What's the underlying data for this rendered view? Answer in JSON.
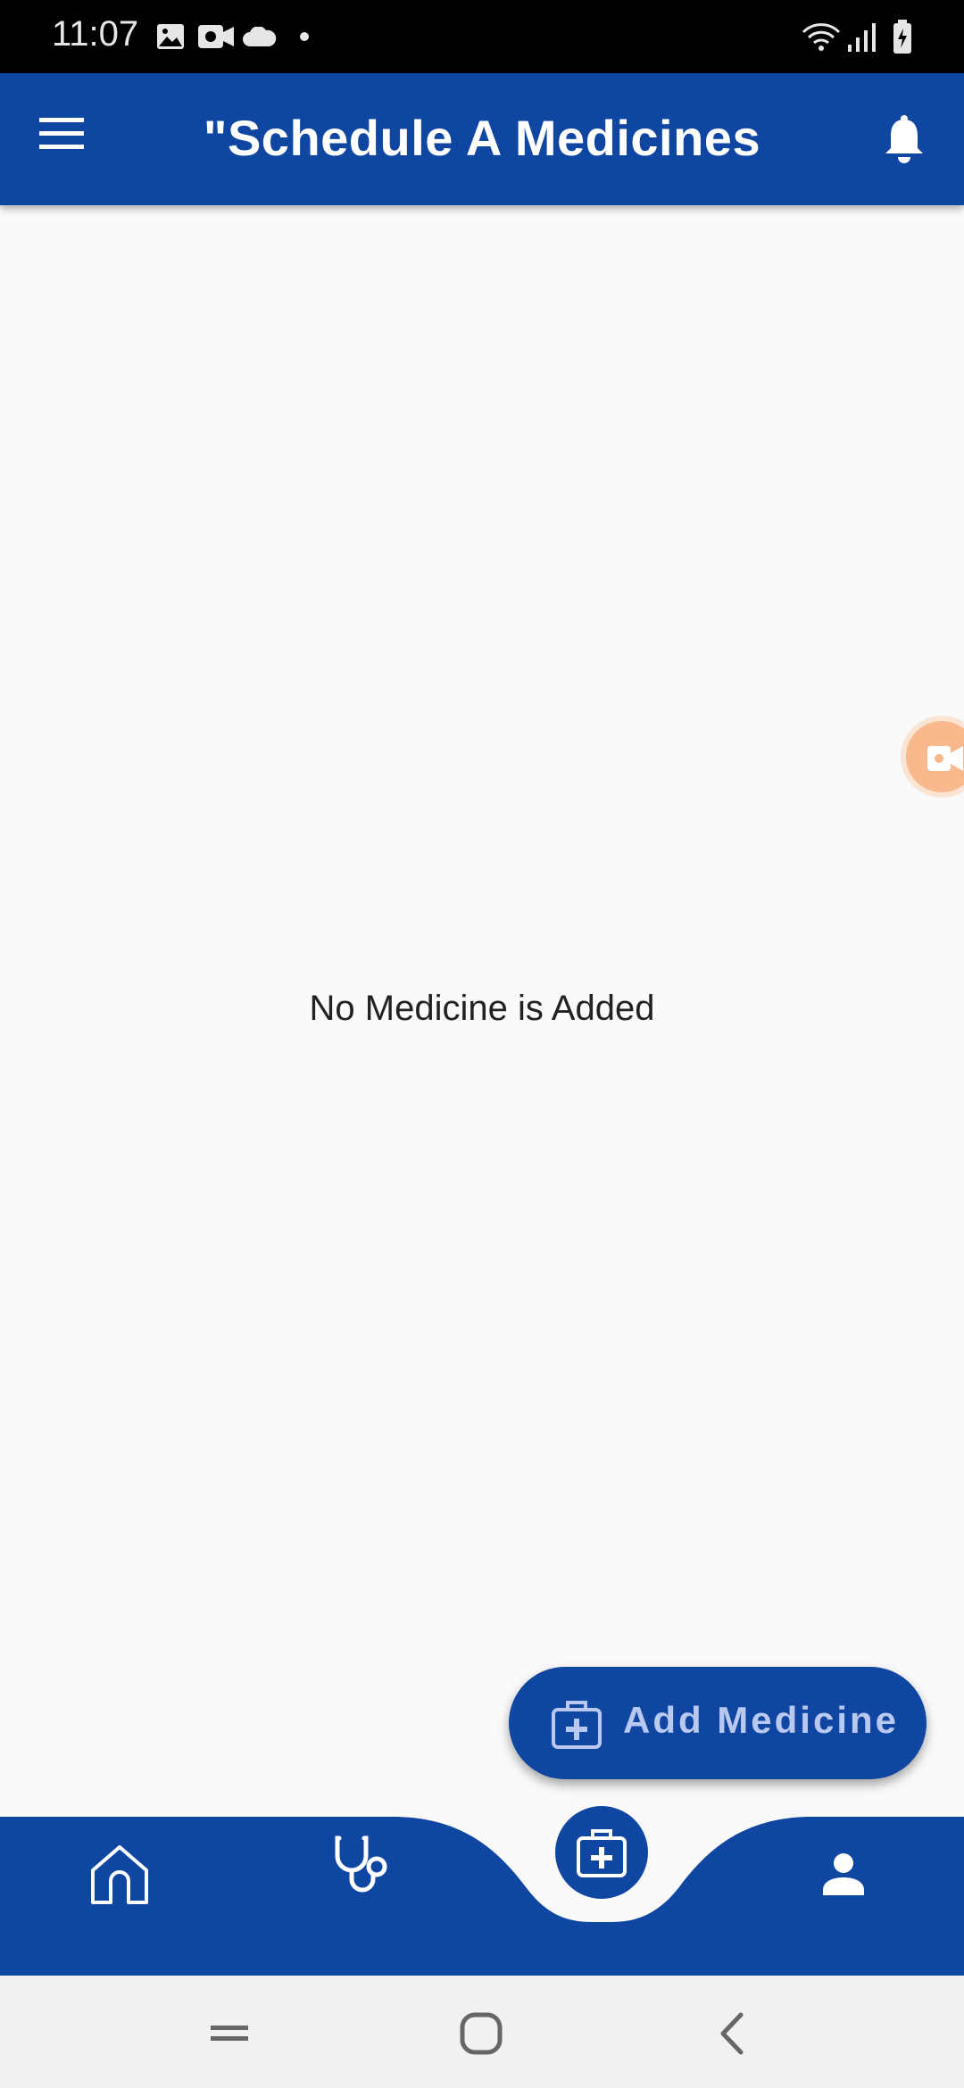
{
  "status_bar": {
    "time": "11:07",
    "left_icons": [
      "image-icon",
      "video-icon",
      "cloud-icon",
      "dot-icon"
    ],
    "right_icons": [
      "wifi-icon",
      "signal-icon",
      "battery-icon"
    ]
  },
  "app_bar": {
    "title": "\"Schedule A Medicines",
    "left_icon": "menu-icon",
    "right_icon": "bell-icon"
  },
  "main": {
    "empty_message": "No Medicine is Added"
  },
  "fab": {
    "label": "Add Medicine",
    "icon": "medical-kit-icon"
  },
  "bottom_nav": {
    "items": [
      {
        "name": "home",
        "icon": "home-icon"
      },
      {
        "name": "doctor",
        "icon": "stethoscope-icon"
      },
      {
        "name": "medicine",
        "icon": "medical-kit-icon"
      },
      {
        "name": "profile",
        "icon": "person-icon"
      }
    ]
  },
  "system_nav": {
    "buttons": [
      "recents-icon",
      "home-icon",
      "back-icon"
    ]
  },
  "colors": {
    "primary": "#0f46a1",
    "background": "#fafafa",
    "fab_text": "#b9c8ee",
    "bubble": "#f9b98d"
  }
}
